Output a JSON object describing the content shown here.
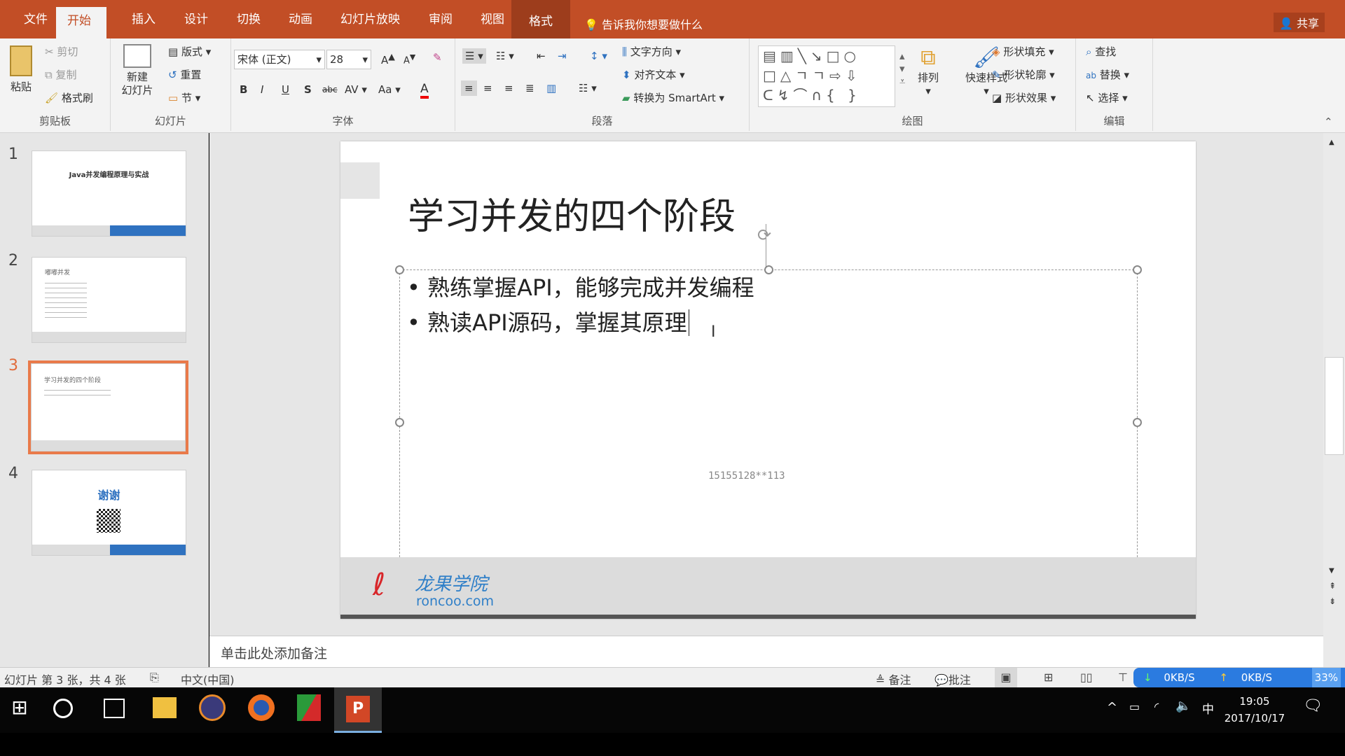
{
  "colors": {
    "accent": "#c24e26",
    "selection": "#e97a4a",
    "netbar": "#2b7be0"
  },
  "tabs": [
    {
      "label": "文件"
    },
    {
      "label": "开始"
    },
    {
      "label": "插入"
    },
    {
      "label": "设计"
    },
    {
      "label": "切换"
    },
    {
      "label": "动画"
    },
    {
      "label": "幻灯片放映"
    },
    {
      "label": "审阅"
    },
    {
      "label": "视图"
    },
    {
      "label": "格式"
    }
  ],
  "tell_me": "告诉我你想要做什么",
  "share": "共享",
  "ribbon": {
    "clipboard": {
      "label": "剪贴板",
      "paste": "粘贴",
      "cut": "剪切",
      "copy": "复制",
      "format_painter": "格式刷"
    },
    "slides": {
      "label": "幻灯片",
      "new_slide": "新建\n幻灯片",
      "layout": "版式",
      "reset": "重置",
      "section": "节"
    },
    "font": {
      "label": "字体",
      "font_name": "宋体 (正文)",
      "font_size": "28",
      "bold": "B",
      "italic": "I",
      "underline": "U",
      "shadow": "S",
      "strike": "abc",
      "spacing": "AV",
      "case": "Aa",
      "color": "A"
    },
    "paragraph": {
      "label": "段落",
      "text_direction": "文字方向",
      "align_text": "对齐文本",
      "smartart": "转换为 SmartArt"
    },
    "drawing": {
      "label": "绘图",
      "arrange": "排列",
      "quick_styles": "快速样式",
      "shape_fill": "形状填充",
      "shape_outline": "形状轮廓",
      "shape_effects": "形状效果"
    },
    "editing": {
      "label": "编辑",
      "find": "查找",
      "replace": "替换",
      "select": "选择"
    }
  },
  "thumbnails": [
    {
      "num": "1",
      "title": "Java并发编程原理与实战"
    },
    {
      "num": "2",
      "title": "嘟嘟并发"
    },
    {
      "num": "3",
      "title": "学习并发的四个阶段"
    },
    {
      "num": "4",
      "title": "谢谢"
    }
  ],
  "slide": {
    "title": "学习并发的四个阶段",
    "bullets": [
      "熟练掌握API，能够完成并发编程",
      "熟读API源码，掌握其原理"
    ],
    "watermark": "15155128**113",
    "logo_cn": "龙果学院",
    "logo_en": "roncoo.com"
  },
  "notes_placeholder": "单击此处添加备注",
  "status": {
    "slide_info": "幻灯片 第 3 张，共 4 张",
    "language": "中文(中国)",
    "notes": "备注",
    "comments": "批注",
    "down": "0KB/S",
    "up": "0KB/S",
    "cpu": "33%"
  },
  "taskbar": {
    "time": "19:05",
    "date": "2017/10/17",
    "ime": "中"
  }
}
